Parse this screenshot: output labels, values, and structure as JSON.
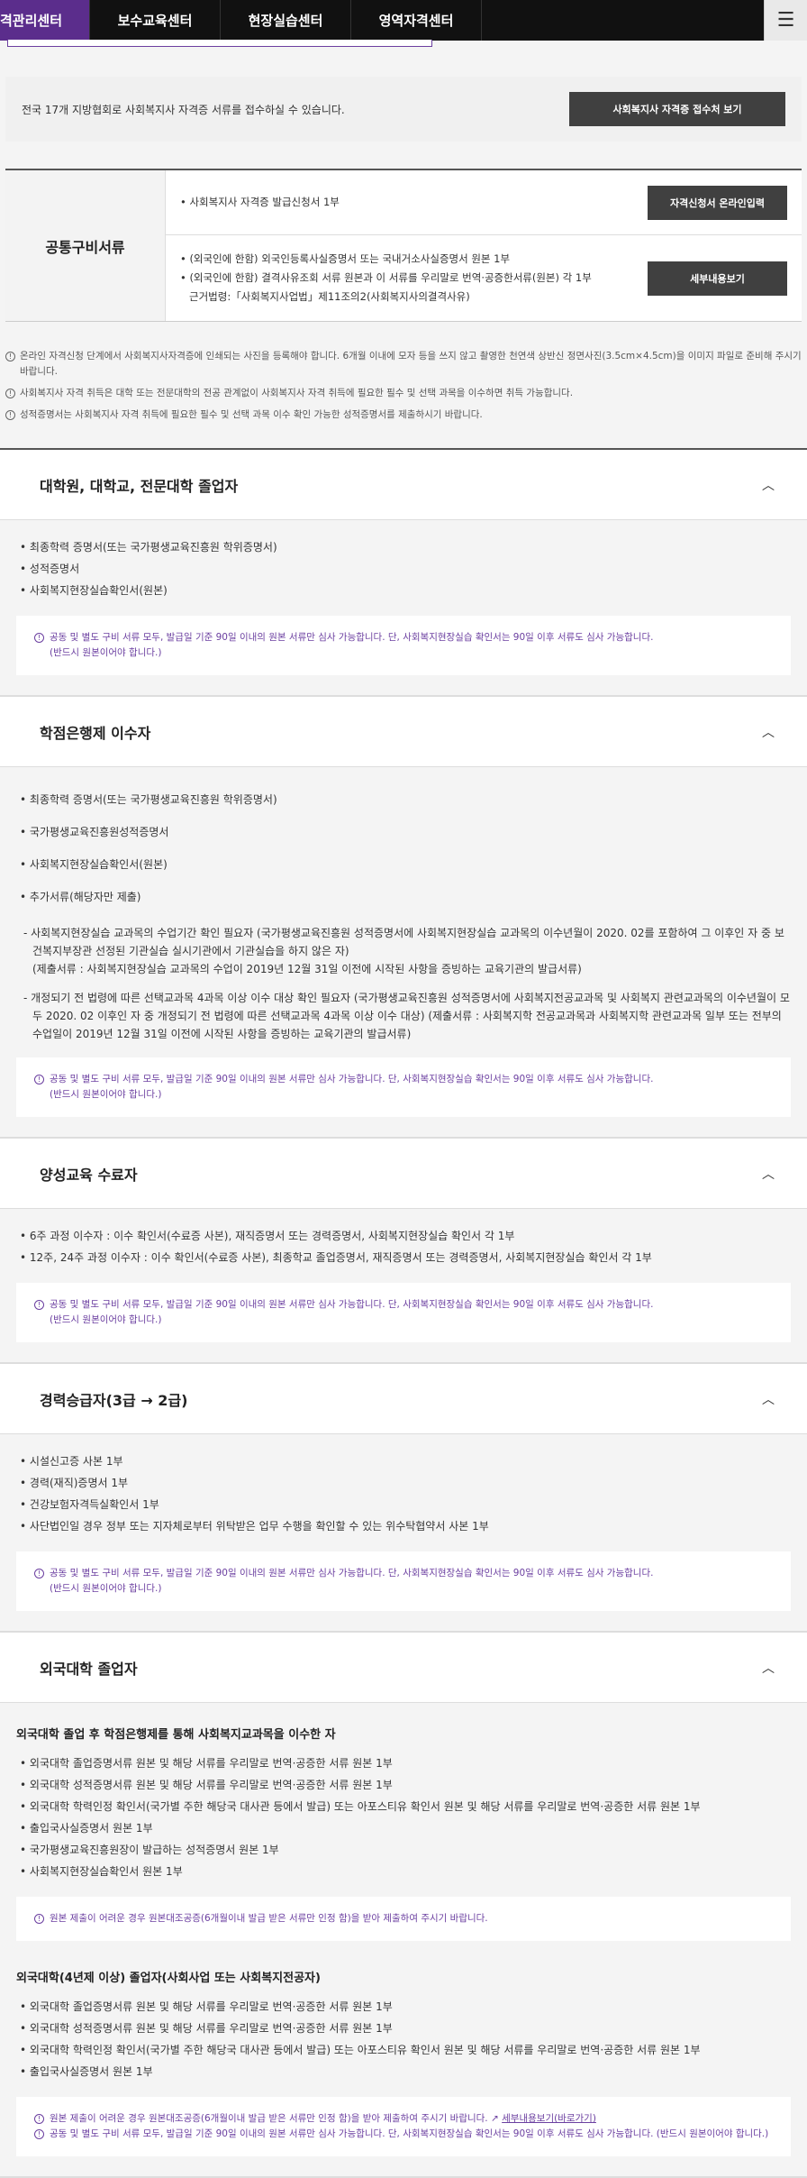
{
  "nav": {
    "tabs": [
      "격관리센터",
      "보수교육센터",
      "현장실습센터",
      "영역자격센터"
    ],
    "menu_icon": "hamburger-icon"
  },
  "top_box": {
    "text": "전국 17개 지방협회로 사회복지사 자격증 서류를 접수하실 수 있습니다.",
    "button": "사회복지사 자격증 접수처 보기"
  },
  "common": {
    "label": "공통구비서류",
    "row1": {
      "lines": [
        "• 사회복지사 자격증 발급신청서 1부"
      ],
      "button": "자격신청서 온라인입력"
    },
    "row2": {
      "lines": [
        "• (외국인에 한함) 외국인등록사실증명서 또는 국내거소사실증명서 원본 1부",
        "• (외국인에 한함) 결격사유조회 서류 원본과 이 서류를 우리말로 번역·공증한서류(원본) 각 1부",
        "근거법령:「사회복지사업법」제11조의2(사회복지사의결격사유)"
      ],
      "button": "세부내용보기"
    }
  },
  "notes": [
    "온라인 자격신청 단계에서 사회복지사자격증에 인쇄되는 사진을 등록해야 합니다. 6개월 이내에 모자 등을 쓰지 않고 촬영한 천연색 상반신 정면사진(3.5cm×4.5cm)을 이미지 파일로 준비해 주시기 바랍니다.",
    "사회복지사 자격 취득은 대학 또는 전문대학의 전공 관계없이 사회복지사 자격 취득에 필요한 필수 및 선택 과목을 이수하면 취득 가능합니다.",
    "성적증명서는 사회복지사 자격 취득에 필요한 필수 및 선택 과목 이수 확인 가능한 성적증명서를 제출하시기 바랍니다."
  ],
  "notice_common": [
    "공동 및 별도 구비 서류 모두, 발급일 기준 90일 이내의 원본 서류만 심사 가능합니다. 단, 사회복지현장실습 확인서는 90일 이후 서류도 심사 가능합니다.",
    "(반드시 원본이어야 합니다.)"
  ],
  "sections": {
    "s1": {
      "title": "대학원, 대학교, 전문대학 졸업자",
      "items": [
        "최종학력 증명서(또는 국가평생교육진흥원 학위증명서)",
        "성적증명서",
        "사회복지현장실습확인서(원본)"
      ]
    },
    "s2": {
      "title": "학점은행제 이수자",
      "items": [
        "최종학력 증명서(또는 국가평생교육진흥원 학위증명서)",
        "국가평생교육진흥원성적증명서",
        "사회복지현장실습확인서(원본)",
        "추가서류(해당자만 제출)"
      ],
      "sub1": "- 사회복지현장실습 교과목의 수업기간 확인 필요자 (국가평생교육진흥원 성적증명서에 사회복지현장실습 교과목의 이수년월이 2020. 02를 포함하여 그 이후인 자 중 보건복지부장관 선정된 기관실습 실시기관에서 기관실습을 하지 않은 자)",
      "sub1b": "(제출서류 : 사회복지현장실습 교과목의 수업이 2019년 12월 31일 이전에 시작된 사항을 증빙하는 교육기관의 발급서류)",
      "sub2": "- 개정되기 전 법령에 따른 선택교과목 4과목 이상 이수 대상 확인 필요자 (국가평생교육진흥원 성적증명서에 사회복지전공교과목 및 사회복지 관련교과목의 이수년월이 모두 2020. 02 이후인 자 중 개정되기 전 법령에 따른 선택교과목 4과목 이상 이수 대상) (제출서류 : 사회복지학 전공교과목과 사회복지학 관련교과목 일부 또는 전부의 수업일이 2019년 12월 31일 이전에 시작된 사항을 증빙하는 교육기관의 발급서류)"
    },
    "s3": {
      "title": "양성교육 수료자",
      "items": [
        "6주 과정 이수자 : 이수 확인서(수료증 사본), 재직증명서 또는 경력증명서, 사회복지현장실습 확인서 각 1부",
        "12주, 24주 과정 이수자 : 이수 확인서(수료증 사본), 최종학교 졸업증명서, 재직증명서 또는 경력증명서, 사회복지현장실습 확인서 각 1부"
      ]
    },
    "s4": {
      "title": "경력승급자(3급 → 2급)",
      "items": [
        "시설신고증 사본 1부",
        "경력(재직)증명서 1부",
        "건강보험자격득실확인서 1부",
        "사단법인일 경우 정부 또는 지자체로부터 위탁받은 업무 수행을 확인할 수 있는 위수탁협약서 사본 1부"
      ]
    },
    "s5": {
      "title": "외국대학 졸업자",
      "sub_a_title": "외국대학 졸업 후 학점은행제를 통해 사회복지교과목을 이수한 자",
      "sub_a_items": [
        "외국대학 졸업증명서류 원본 및 해당 서류를 우리말로 번역·공증한 서류 원본 1부",
        "외국대학 성적증명서류 원본 및 해당 서류를 우리말로 번역·공증한 서류 원본 1부",
        "외국대학 학력인정 확인서(국가별 주한 해당국 대사관 등에서 발급) 또는 아포스티유 확인서 원본 및 해당 서류를 우리말로 번역·공증한 서류 원본 1부",
        "출입국사실증명서 원본 1부",
        "국가평생교육진흥원장이 발급하는 성적증명서 원본 1부",
        "사회복지현장실습확인서 원본 1부"
      ],
      "sub_a_notice": "원본 제출이 어려운 경우 원본대조공증(6개월이내 발급 받은 서류만 인정 함)을 받아 제출하여 주시기 바랍니다.",
      "sub_b_title": "외국대학(4년제 이상) 졸업자(사회사업 또는 사회복지전공자)",
      "sub_b_items": [
        "외국대학 졸업증명서류 원본 및 해당 서류를 우리말로 번역·공증한 서류 원본 1부",
        "외국대학 성적증명서류 원본 및 해당 서류를 우리말로 번역·공증한 서류 원본 1부",
        "외국대학 학력인정 확인서(국가별 주한 해당국 대사관 등에서 발급) 또는 아포스티유 확인서 원본 및 해당 서류를 우리말로 번역·공증한 서류 원본 1부",
        "출입국사실증명서 원본 1부"
      ],
      "sub_b_notice1": "원본 제출이 어려운 경우 원본대조공증(6개월이내 발급 받은 서류만 인정 함)을 받아 제출하여 주시기 바랍니다.",
      "sub_b_link": "세부내용보기(바로가기)",
      "sub_b_notice2": "공동 및 별도 구비 서류 모두, 발급일 기준 90일 이내의 원본 서류만 심사 가능합니다. 단, 사회복지현장실습 확인서는 90일 이후 서류도 심사 가능합니다. (반드시 원본이어야 합니다.)"
    }
  }
}
